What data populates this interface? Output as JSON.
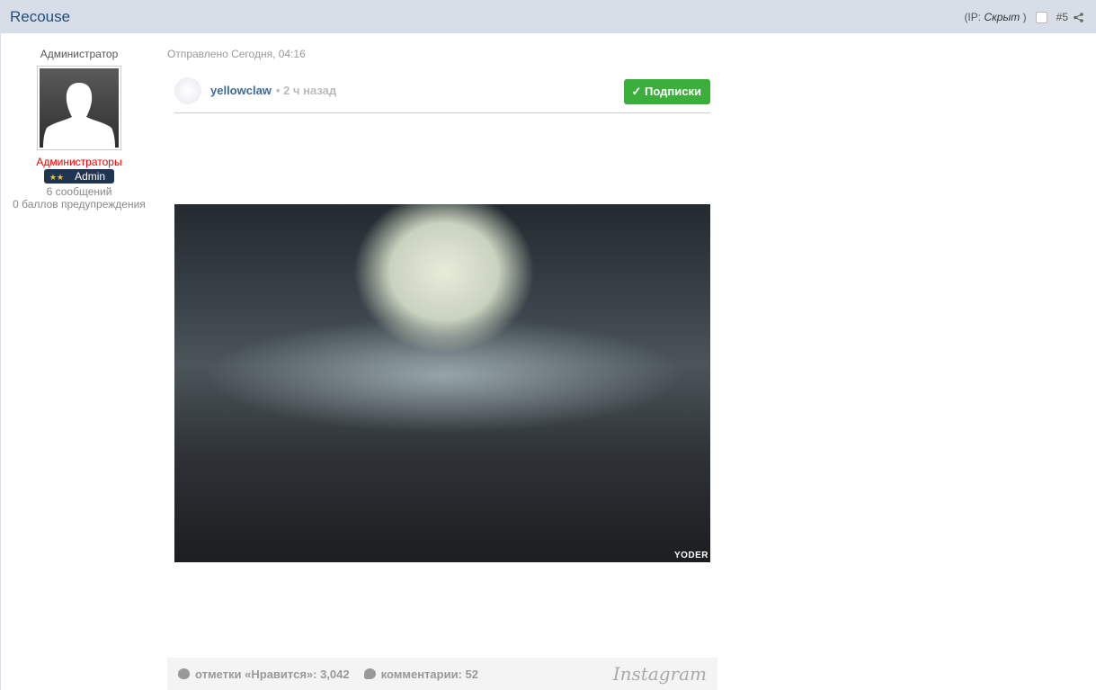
{
  "header": {
    "title": "Recouse",
    "ip_label": "(IP:",
    "ip_value": "Скрыт",
    "ip_close": ")",
    "post_number": "#5"
  },
  "author": {
    "role": "Администратор",
    "group": "Администраторы",
    "badge_label": "Admin",
    "badge_stars": "★★",
    "posts": "6 сообщений",
    "warnings": "0 баллов предупреждения"
  },
  "post": {
    "posted": "Отправлено Сегодня, 04:16"
  },
  "instagram": {
    "username": "yellowclaw",
    "time": "• 2 ч назад",
    "follow_label": "✓ Подписки",
    "watermark": "YODER",
    "likes": "отметки «Нравится»: 3,042",
    "comments": "комментарии: 52",
    "brand": "Instagram"
  },
  "colors": {
    "follow": "#3cae3c",
    "group": "#ee0000",
    "header_bg": "#d8dee8"
  }
}
